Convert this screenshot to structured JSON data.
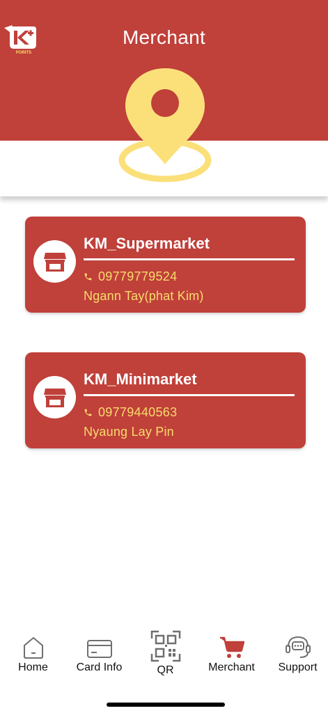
{
  "header": {
    "title": "Merchant",
    "logo_icon": "k-points-logo-icon",
    "hero_icon": "location-pin-icon"
  },
  "merchants": [
    {
      "name": "KM_Supermarket",
      "phone": "09779779524",
      "address": "Ngann Tay(phat Kim)"
    },
    {
      "name": "KM_Minimarket",
      "phone": "09779440563",
      "address": "Nyaung Lay Pin"
    }
  ],
  "nav": {
    "items": [
      {
        "label": "Home",
        "icon": "home-icon",
        "active": false
      },
      {
        "label": "Card Info",
        "icon": "card-icon",
        "active": false
      },
      {
        "label": "QR",
        "icon": "qr-code-icon",
        "active": false
      },
      {
        "label": "Merchant",
        "icon": "cart-icon",
        "active": true
      },
      {
        "label": "Support",
        "icon": "headset-chat-icon",
        "active": false
      }
    ]
  },
  "colors": {
    "brand_red": "#c0403a",
    "accent_yellow": "#f7dc6b",
    "pin_yellow": "#fbe07a",
    "icon_gray": "#6f6f6f"
  }
}
